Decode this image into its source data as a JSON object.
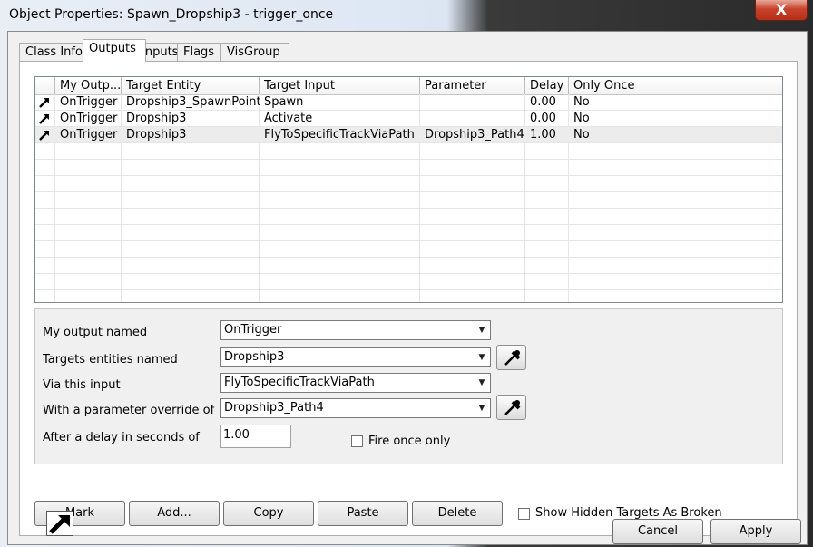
{
  "window": {
    "title": "Object Properties: Spawn_Dropship3 - trigger_once",
    "close_label": "X"
  },
  "tabs": [
    {
      "label": "Class Info"
    },
    {
      "label": "Outputs"
    },
    {
      "label": "Inputs"
    },
    {
      "label": "Flags"
    },
    {
      "label": "VisGroup"
    }
  ],
  "outputs_table": {
    "headers": [
      "My Outp...",
      "Target Entity",
      "Target Input",
      "Parameter",
      "Delay",
      "Only Once"
    ],
    "rows": [
      {
        "output": "OnTrigger",
        "target": "Dropship3_SpawnPoint",
        "input": "Spawn",
        "param": "",
        "delay": "0.00",
        "once": "No"
      },
      {
        "output": "OnTrigger",
        "target": "Dropship3",
        "input": "Activate",
        "param": "",
        "delay": "0.00",
        "once": "No"
      },
      {
        "output": "OnTrigger",
        "target": "Dropship3",
        "input": "FlyToSpecificTrackViaPath",
        "param": "Dropship3_Path4",
        "delay": "1.00",
        "once": "No"
      }
    ]
  },
  "editor": {
    "output_label": "My output named",
    "output_value": "OnTrigger",
    "targets_label": "Targets entities named",
    "targets_value": "Dropship3",
    "input_label": "Via this input",
    "input_value": "FlyToSpecificTrackViaPath",
    "param_label": "With a parameter override of",
    "param_value": "Dropship3_Path4",
    "delay_label": "After a delay in seconds of",
    "delay_value": "1.00",
    "fire_once_label": "Fire once only"
  },
  "buttons": {
    "mark": "Mark",
    "add": "Add...",
    "copy": "Copy",
    "paste": "Paste",
    "delete": "Delete",
    "show_hidden_label": "Show Hidden Targets As Broken",
    "cancel": "Cancel",
    "apply": "Apply"
  },
  "icons": {
    "row_icon": "output-arrow-icon",
    "picker_icon": "eyedropper-icon",
    "dropdown_icon": "chevron-down-icon"
  }
}
